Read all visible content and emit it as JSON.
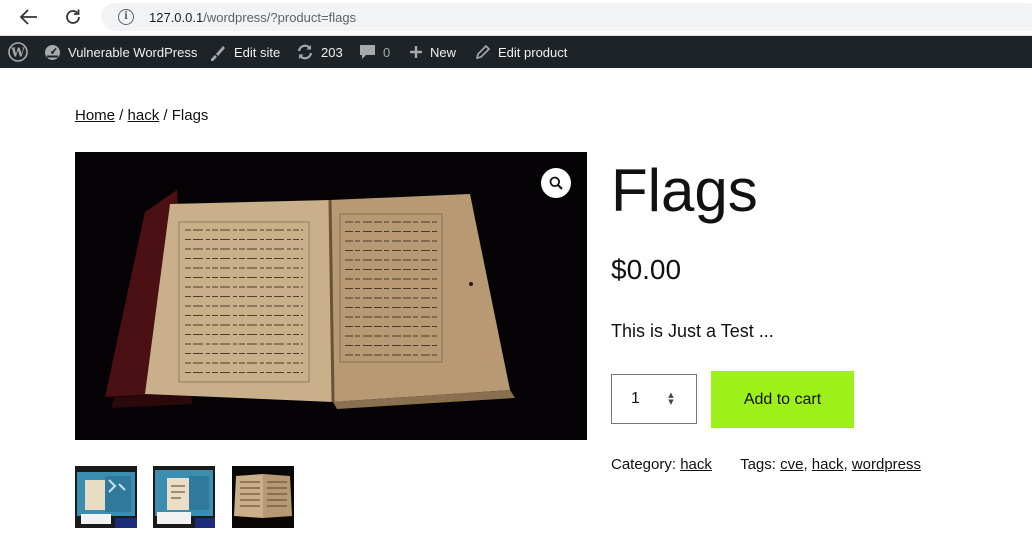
{
  "browser": {
    "url_host": "127.0.0.1",
    "url_path": "/wordpress/?product=flags",
    "icons": {
      "back": "arrow-left-icon",
      "reload": "reload-icon",
      "info": "info-icon"
    }
  },
  "admin_bar": {
    "site_name": "Vulnerable WordPress",
    "edit_site": "Edit site",
    "updates_count": "203",
    "comments_count": "0",
    "new_label": "New",
    "edit_product": "Edit product",
    "icons": {
      "wp_logo": "wordpress-logo-icon",
      "site": "dashboard-icon",
      "edit_site": "brush-icon",
      "updates": "updates-icon",
      "comments": "comment-bubble-icon",
      "new": "plus-icon",
      "edit_product": "pencil-icon"
    }
  },
  "breadcrumb": {
    "home": "Home",
    "sep1": " / ",
    "category": "hack",
    "sep2": " / ",
    "current": "Flags"
  },
  "product": {
    "title": "Flags",
    "price": "$0.00",
    "short_description": "This is Just a Test ...",
    "quantity": "1",
    "add_to_cart_label": "Add to cart",
    "meta": {
      "category_label": "Category: ",
      "category": "hack",
      "tags_label": "Tags: ",
      "tags": [
        "cve",
        "hack",
        "wordpress"
      ],
      "tag_separator": ", "
    }
  },
  "colors": {
    "admin_bar_bg": "#1d2327",
    "add_to_cart_bg": "#9ef01a",
    "gallery_bg": "#050305"
  }
}
